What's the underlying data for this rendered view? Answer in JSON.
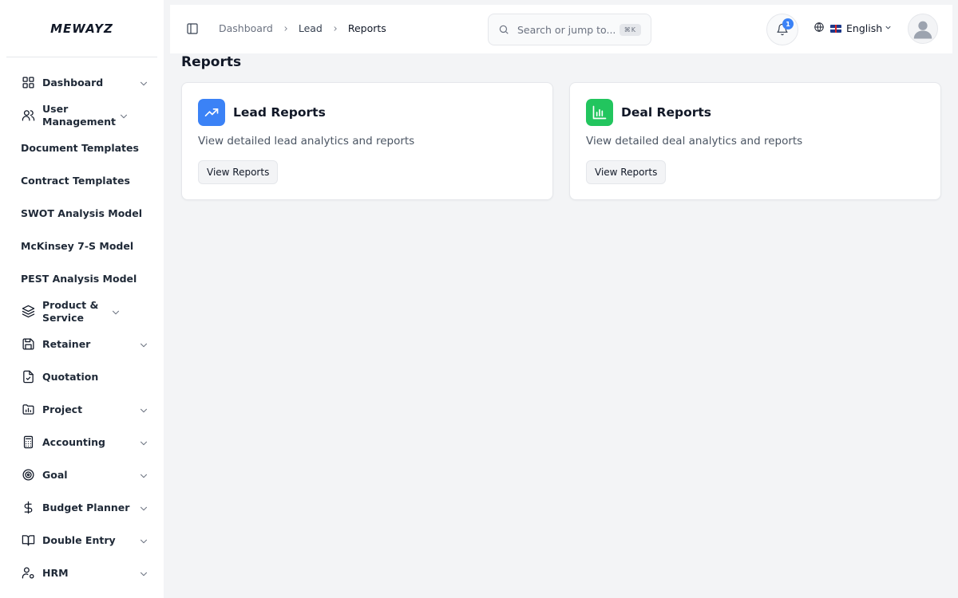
{
  "app": {
    "logo_text": "MEWAYZ"
  },
  "sidebar": {
    "items": [
      {
        "label": "Dashboard",
        "icon": "grid-icon",
        "has_chevron": true
      },
      {
        "label": "User Management",
        "icon": "users-icon",
        "has_chevron": true
      },
      {
        "label": "Document Templates",
        "icon": "",
        "has_chevron": false
      },
      {
        "label": "Contract Templates",
        "icon": "",
        "has_chevron": false
      },
      {
        "label": "SWOT Analysis Model",
        "icon": "",
        "has_chevron": false
      },
      {
        "label": "McKinsey 7-S Model",
        "icon": "",
        "has_chevron": false
      },
      {
        "label": "PEST Analysis Model",
        "icon": "",
        "has_chevron": false
      },
      {
        "label": "Product & Service",
        "icon": "layers-icon",
        "has_chevron": true
      },
      {
        "label": "Retainer",
        "icon": "save-icon",
        "has_chevron": true
      },
      {
        "label": "Quotation",
        "icon": "file-check-icon",
        "has_chevron": false
      },
      {
        "label": "Project",
        "icon": "folder-chart-icon",
        "has_chevron": true
      },
      {
        "label": "Accounting",
        "icon": "calculator-icon",
        "has_chevron": true
      },
      {
        "label": "Goal",
        "icon": "target-icon",
        "has_chevron": true
      },
      {
        "label": "Budget Planner",
        "icon": "dollar-icon",
        "has_chevron": true
      },
      {
        "label": "Double Entry",
        "icon": "book-icon",
        "has_chevron": true
      },
      {
        "label": "HRM",
        "icon": "user-cog-icon",
        "has_chevron": true
      }
    ]
  },
  "topbar": {
    "breadcrumb": [
      "Dashboard",
      "Lead",
      "Reports"
    ],
    "search_placeholder": "Search or jump to...",
    "search_shortcut": "⌘K",
    "notification_count": "1",
    "language": "English"
  },
  "page": {
    "title": "Reports",
    "cards": [
      {
        "title": "Lead Reports",
        "description": "View detailed lead analytics and reports",
        "button": "View Reports",
        "icon": "trending-up-icon",
        "color": "#3b82f6"
      },
      {
        "title": "Deal Reports",
        "description": "View detailed deal analytics and reports",
        "button": "View Reports",
        "icon": "bar-chart-icon",
        "color": "#22c55e"
      }
    ]
  }
}
